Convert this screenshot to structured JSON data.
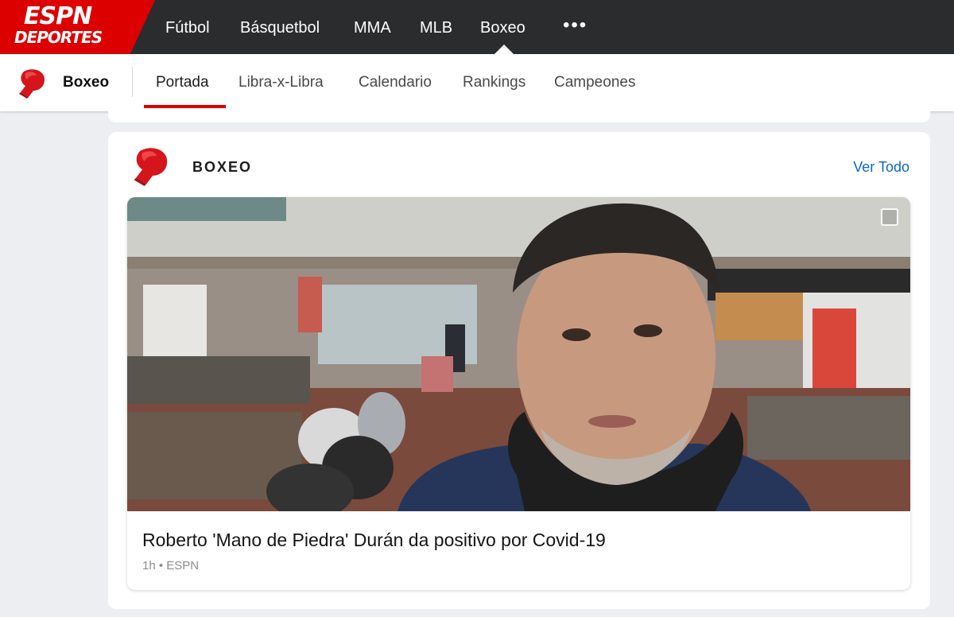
{
  "logo": {
    "line1": "ESPN",
    "line2": "DEPORTES",
    "brand_color": "#dd0000"
  },
  "top_nav": {
    "items": [
      "Fútbol",
      "Básquetbol",
      "MMA",
      "MLB",
      "Boxeo"
    ],
    "more": "•••",
    "active": "Boxeo"
  },
  "sub_nav": {
    "icon": "boxing-glove-icon",
    "title": "Boxeo",
    "tabs": [
      "Portada",
      "Libra-x-Libra",
      "Calendario",
      "Rankings",
      "Campeones"
    ],
    "active_tab": "Portada"
  },
  "section": {
    "icon": "boxing-glove-icon",
    "title": "BOXEO",
    "see_all": "Ver Todo",
    "link_color": "#0a68c9"
  },
  "story": {
    "headline": "Roberto 'Mano de Piedra' Durán da positivo por Covid-19",
    "time": "1h",
    "separator": "•",
    "source": "ESPN",
    "image_icon": "image-gallery-icon"
  }
}
